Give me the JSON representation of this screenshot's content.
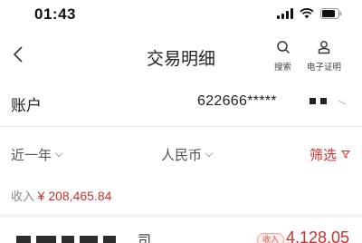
{
  "status_bar": {
    "time": "01:43",
    "icons": [
      "signal-icon",
      "wifi-icon",
      "battery-icon"
    ]
  },
  "nav": {
    "back_icon": "chevron-left-icon",
    "title": "交易明细",
    "search_label": "搜索",
    "ecert_label": "电子证明"
  },
  "account": {
    "label": "账户",
    "number": "622666*****"
  },
  "filters": {
    "period": "近一年",
    "currency": "人民币",
    "screen": "筛选"
  },
  "income": {
    "label": "收入",
    "value": "¥ 208,465.84"
  },
  "transaction": {
    "name": "司",
    "badge": "收入",
    "amount": "4,128.05"
  },
  "colors": {
    "accent": "#c9302c",
    "text": "#222222",
    "muted": "#888888",
    "divider": "#ececec"
  }
}
